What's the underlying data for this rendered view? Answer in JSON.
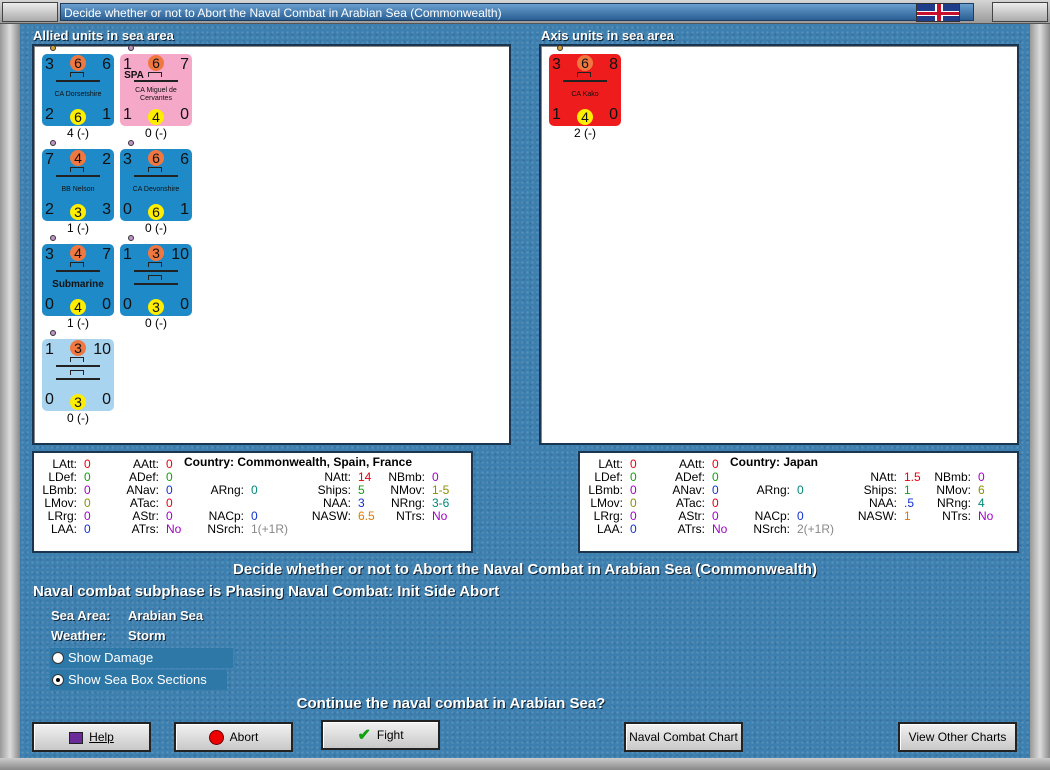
{
  "window": {
    "title": "Decide whether or not to Abort the Naval Combat in Arabian Sea (Commonwealth)"
  },
  "allied": {
    "header": "Allied units in sea area",
    "units": [
      {
        "tl": "3",
        "att": "6",
        "tr": "6",
        "name": "CA Dorsetshire",
        "bl": "2",
        "def": "6",
        "br": "1",
        "count": "4 (-)",
        "color": "#1e8ac8",
        "defcolor": "#ffee00"
      },
      {
        "tl": "1",
        "att": "6",
        "tr": "7",
        "name": "CA Miguel de Cervantes",
        "tag": "SPA",
        "bl": "1",
        "def": "4",
        "br": "0",
        "count": "0 (-)",
        "color": "#f5a8c8",
        "defcolor": "#ffee00"
      },
      {
        "tl": "7",
        "att": "4",
        "tr": "2",
        "name": "BB Nelson",
        "bl": "2",
        "def": "3",
        "br": "3",
        "count": "1 (-)",
        "color": "#1e8ac8",
        "defcolor": "#ffee00"
      },
      {
        "tl": "3",
        "att": "6",
        "tr": "6",
        "name": "CA Devonshire",
        "bl": "0",
        "def": "6",
        "br": "1",
        "count": "0 (-)",
        "color": "#1e8ac8",
        "defcolor": "#ffee00"
      },
      {
        "tl": "3",
        "att": "4",
        "tr": "7",
        "name": "Submarine",
        "bl": "0",
        "def": "4",
        "br": "0",
        "count": "1 (-)",
        "color": "#1e8ac8",
        "defcolor": "#ffee00"
      },
      {
        "tl": "1",
        "att": "3",
        "tr": "10",
        "name": "",
        "bl": "0",
        "def": "3",
        "br": "0",
        "count": "0 (-)",
        "color": "#1e8ac8",
        "defcolor": "#ffee00"
      },
      {
        "tl": "1",
        "att": "3",
        "tr": "10",
        "name": "",
        "bl": "0",
        "def": "3",
        "br": "0",
        "count": "0 (-)",
        "color": "#a8d4f0",
        "defcolor": "#ffee00"
      }
    ]
  },
  "axis": {
    "header": "Axis units in sea area",
    "units": [
      {
        "tl": "3",
        "att": "6",
        "tr": "8",
        "name": "CA Kako",
        "bl": "1",
        "def": "4",
        "br": "0",
        "count": "2 (-)",
        "color": "#ee1c1c",
        "defcolor": "#ffee00"
      }
    ]
  },
  "allied_stats": {
    "country": "Country: Commonwealth, Spain, France",
    "LAtt": "0",
    "LDef": "0",
    "LBmb": "0",
    "LMov": "0",
    "LRrg": "0",
    "LAA": "0",
    "AAtt": "0",
    "ADef": "0",
    "ANav": "0",
    "ATac": "0",
    "AStr": "0",
    "ATrs": "No",
    "ARng": "0",
    "NACp": "0",
    "NSrch": "1(+1R)",
    "NAtt": "14",
    "Ships": "5",
    "NAA": "3",
    "NASW": "6.5",
    "NBmb": "0",
    "NMov": "1-5",
    "NRng": "3-6",
    "NTrs": "No"
  },
  "axis_stats": {
    "country": "Country: Japan",
    "LAtt": "0",
    "LDef": "0",
    "LBmb": "0",
    "LMov": "0",
    "LRrg": "0",
    "LAA": "0",
    "AAtt": "0",
    "ADef": "0",
    "ANav": "0",
    "ATac": "0",
    "AStr": "0",
    "ATrs": "No",
    "ARng": "0",
    "NACp": "0",
    "NSrch": "2(+1R)",
    "NAtt": "1.5",
    "Ships": "1",
    "NAA": ".5",
    "NASW": "1",
    "NBmb": "0",
    "NMov": "6",
    "NRng": "4",
    "NTrs": "No"
  },
  "labels": {
    "LAtt": "LAtt:",
    "LDef": "LDef:",
    "LBmb": "LBmb:",
    "LMov": "LMov:",
    "LRrg": "LRrg:",
    "LAA": "LAA:",
    "AAtt": "AAtt:",
    "ADef": "ADef:",
    "ANav": "ANav:",
    "ATac": "ATac:",
    "AStr": "AStr:",
    "ATrs": "ATrs:",
    "ARng": "ARng:",
    "NACp": "NACp:",
    "NSrch": "NSrch:",
    "NAtt": "NAtt:",
    "Ships": "Ships:",
    "NAA": "NAA:",
    "NASW": "NASW:",
    "NBmb": "NBmb:",
    "NMov": "NMov:",
    "NRng": "NRng:",
    "NTrs": "NTrs:"
  },
  "main": {
    "heading": "Decide whether or not to Abort the Naval Combat in Arabian Sea (Commonwealth)",
    "subphase": "Naval combat subphase is Phasing Naval Combat: Init Side Abort",
    "sea_area_label": "Sea Area:",
    "sea_area": "Arabian Sea",
    "weather_label": "Weather:",
    "weather": "Storm",
    "show_damage": "Show Damage",
    "show_sections": "Show Sea Box Sections",
    "question": "Continue the naval combat in Arabian Sea?"
  },
  "buttons": {
    "help": "Help",
    "abort": "Abort",
    "fight": "Fight",
    "chart": "Naval Combat Chart",
    "other": "View Other Charts"
  },
  "colors": {
    "red": "#e8000f",
    "green": "#10a010",
    "blue": "#1030d0",
    "orange": "#e07800",
    "purple": "#a000c8",
    "olive": "#889000",
    "teal": "#008878"
  }
}
